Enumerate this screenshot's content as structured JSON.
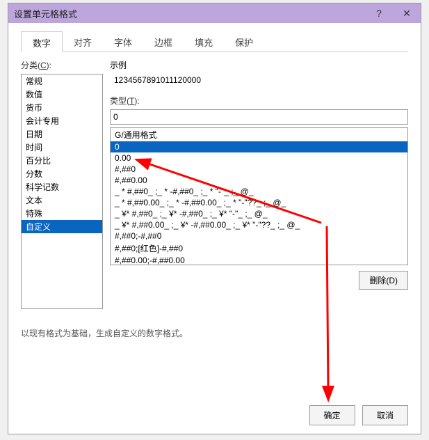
{
  "title": "设置单元格格式",
  "help": "?",
  "close": "✕",
  "tabs": [
    "数字",
    "对齐",
    "字体",
    "边框",
    "填充",
    "保护"
  ],
  "activeTab": 0,
  "category": {
    "label": "分类(",
    "ul": "C",
    "after": "):"
  },
  "categories": [
    "常规",
    "数值",
    "货币",
    "会计专用",
    "日期",
    "时间",
    "百分比",
    "分数",
    "科学记数",
    "文本",
    "特殊",
    "自定义"
  ],
  "categorySelected": 11,
  "sample": {
    "label": "示例",
    "value": "1234567891011120000"
  },
  "type": {
    "label": "类型(",
    "ul": "T",
    "after": "):"
  },
  "typeValue": "0",
  "typeItems": [
    "G/通用格式",
    "0",
    "0.00",
    "#,##0",
    "#,##0.00",
    "_ * #,##0_ ;_ * -#,##0_ ;_ * \"-\"_ ;_ @_ ",
    "_ * #,##0.00_ ;_ * -#,##0.00_ ;_ * \"-\"??_ ;_ @_ ",
    "_ ¥* #,##0_ ;_ ¥* -#,##0_ ;_ ¥* \"-\"_ ;_ @_ ",
    "_ ¥* #,##0.00_ ;_ ¥* -#,##0.00_ ;_ ¥* \"-\"??_ ;_ @_ ",
    "#,##0;-#,##0",
    "#,##0;[红色]-#,##0",
    "#,##0.00;-#,##0.00"
  ],
  "typeSelected": 1,
  "deleteBtn": "删除(D)",
  "hint": "以现有格式为基础，生成自定义的数字格式。",
  "ok": "确定",
  "cancel": "取消"
}
